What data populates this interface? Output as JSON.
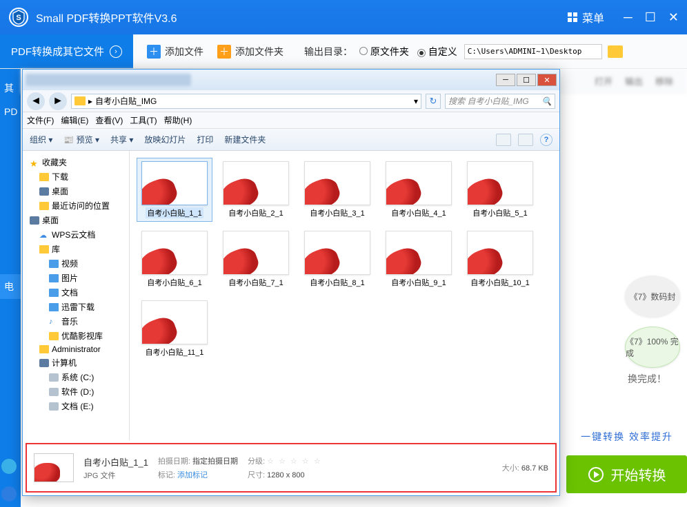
{
  "app": {
    "title": "Small  PDF转换PPT软件V3.6",
    "menu_label": "菜单"
  },
  "sidebar_tab": {
    "label": "PDF转换成其它文件"
  },
  "left_items": [
    "其",
    "PD",
    "电"
  ],
  "toolbar": {
    "add_file": "添加文件",
    "add_folder": "添加文件夹",
    "output_label": "输出目录：",
    "radio_original": "原文件夹",
    "radio_custom": "自定义",
    "path": "C:\\Users\\ADMINI~1\\Desktop"
  },
  "actions": {
    "open": "打开",
    "output": "输出",
    "remove": "移除"
  },
  "right": {
    "bubble1": "《7》数码封",
    "bubble2_pref": "《7》",
    "bubble2_pct": "100%",
    "bubble2_done": "完成",
    "complete_text": "换完成！",
    "link": "一键转换  效率提升",
    "start": "开始转换"
  },
  "dialog": {
    "breadcrumb": "自考小白贴_IMG",
    "search_placeholder": "搜索 自考小白贴_IMG",
    "menubar": [
      "文件(F)",
      "编辑(E)",
      "查看(V)",
      "工具(T)",
      "帮助(H)"
    ],
    "toolbar": {
      "organize": "组织 ▾",
      "preview": "预览 ▾",
      "share": "共享 ▾",
      "slideshow": "放映幻灯片",
      "print": "打印",
      "newfolder": "新建文件夹"
    },
    "tree": [
      {
        "lvl": 1,
        "icon": "star",
        "label": "收藏夹"
      },
      {
        "lvl": 2,
        "icon": "folder",
        "label": "下载"
      },
      {
        "lvl": 2,
        "icon": "monitor",
        "label": "桌面"
      },
      {
        "lvl": 2,
        "icon": "folder",
        "label": "最近访问的位置"
      },
      {
        "lvl": 1,
        "icon": "monitor",
        "label": "桌面"
      },
      {
        "lvl": 2,
        "icon": "cloud",
        "label": "WPS云文档"
      },
      {
        "lvl": 2,
        "icon": "folder",
        "label": "库"
      },
      {
        "lvl": 3,
        "icon": "blue",
        "label": "视频"
      },
      {
        "lvl": 3,
        "icon": "blue",
        "label": "图片"
      },
      {
        "lvl": 3,
        "icon": "blue",
        "label": "文档"
      },
      {
        "lvl": 3,
        "icon": "blue",
        "label": "迅雷下载"
      },
      {
        "lvl": 3,
        "icon": "music",
        "label": "音乐"
      },
      {
        "lvl": 3,
        "icon": "folder",
        "label": "优酷影视库"
      },
      {
        "lvl": 2,
        "icon": "folder",
        "label": "Administrator"
      },
      {
        "lvl": 2,
        "icon": "monitor",
        "label": "计算机"
      },
      {
        "lvl": 3,
        "icon": "drive",
        "label": "系统 (C:)"
      },
      {
        "lvl": 3,
        "icon": "drive",
        "label": "软件 (D:)"
      },
      {
        "lvl": 3,
        "icon": "drive",
        "label": "文档 (E:)"
      }
    ],
    "files": [
      "自考小白贴_1_1",
      "自考小白贴_2_1",
      "自考小白贴_3_1",
      "自考小白贴_4_1",
      "自考小白贴_5_1",
      "自考小白贴_6_1",
      "自考小白贴_7_1",
      "自考小白贴_8_1",
      "自考小白贴_9_1",
      "自考小白贴_10_1",
      "自考小白贴_11_1"
    ],
    "details": {
      "name": "自考小白贴_1_1",
      "type": "JPG 文件",
      "date_label": "拍摄日期:",
      "date_val": "指定拍摄日期",
      "tag_label": "标记:",
      "tag_val": "添加标记",
      "rating_label": "分级:",
      "dim_label": "尺寸:",
      "dim_val": "1280 x 800",
      "size_label": "大小:",
      "size_val": "68.7 KB"
    }
  }
}
